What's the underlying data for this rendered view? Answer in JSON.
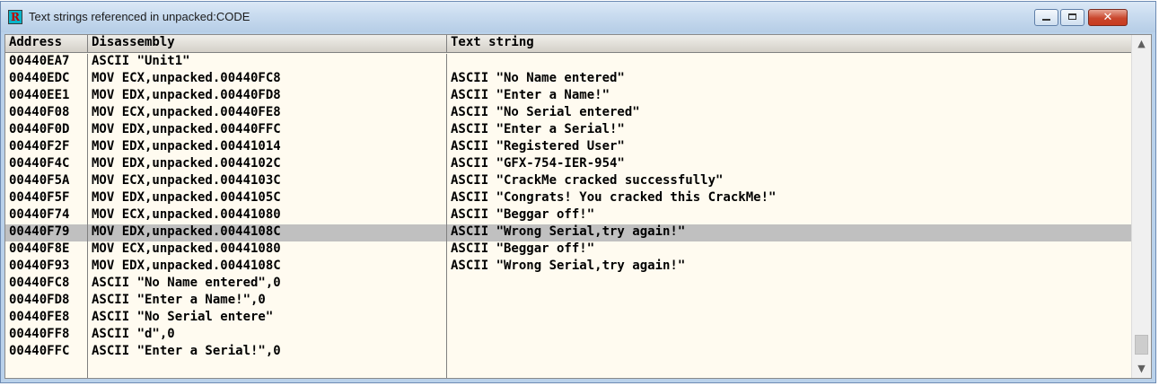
{
  "window": {
    "title": "Text strings referenced in unpacked:CODE",
    "app_icon_letter": "R",
    "controls": {
      "minimize": "minimize",
      "maximize": "maximize",
      "close": "✕"
    }
  },
  "table": {
    "columns": [
      "Address",
      "Disassembly",
      "Text string"
    ],
    "selected_row": 10,
    "rows": [
      {
        "address": "00440EA7",
        "disassembly": "ASCII \"Unit1\"",
        "text": ""
      },
      {
        "address": "00440EDC",
        "disassembly": "MOV ECX,unpacked.00440FC8",
        "text": "ASCII \"No Name entered\""
      },
      {
        "address": "00440EE1",
        "disassembly": "MOV EDX,unpacked.00440FD8",
        "text": "ASCII \"Enter a Name!\""
      },
      {
        "address": "00440F08",
        "disassembly": "MOV ECX,unpacked.00440FE8",
        "text": "ASCII \"No Serial entered\""
      },
      {
        "address": "00440F0D",
        "disassembly": "MOV EDX,unpacked.00440FFC",
        "text": "ASCII \"Enter a Serial!\""
      },
      {
        "address": "00440F2F",
        "disassembly": "MOV EDX,unpacked.00441014",
        "text": "ASCII \"Registered User\""
      },
      {
        "address": "00440F4C",
        "disassembly": "MOV EDX,unpacked.0044102C",
        "text": "ASCII \"GFX-754-IER-954\""
      },
      {
        "address": "00440F5A",
        "disassembly": "MOV ECX,unpacked.0044103C",
        "text": "ASCII \"CrackMe cracked successfully\""
      },
      {
        "address": "00440F5F",
        "disassembly": "MOV EDX,unpacked.0044105C",
        "text": "ASCII \"Congrats! You cracked this CrackMe!\""
      },
      {
        "address": "00440F74",
        "disassembly": "MOV ECX,unpacked.00441080",
        "text": "ASCII \"Beggar off!\""
      },
      {
        "address": "00440F79",
        "disassembly": "MOV EDX,unpacked.0044108C",
        "text": "ASCII \"Wrong Serial,try again!\""
      },
      {
        "address": "00440F8E",
        "disassembly": "MOV ECX,unpacked.00441080",
        "text": "ASCII \"Beggar off!\""
      },
      {
        "address": "00440F93",
        "disassembly": "MOV EDX,unpacked.0044108C",
        "text": "ASCII \"Wrong Serial,try again!\""
      },
      {
        "address": "00440FC8",
        "disassembly": "ASCII \"No Name entered\",0",
        "text": ""
      },
      {
        "address": "00440FD8",
        "disassembly": "ASCII \"Enter a Name!\",0",
        "text": ""
      },
      {
        "address": "00440FE8",
        "disassembly": "ASCII \"No Serial entere\"",
        "text": ""
      },
      {
        "address": "00440FF8",
        "disassembly": "ASCII \"d\",0",
        "text": ""
      },
      {
        "address": "00440FFC",
        "disassembly": "ASCII \"Enter a Serial!\",0",
        "text": ""
      }
    ]
  },
  "scrollbar": {
    "up_icon": "▲",
    "down_icon": "▼"
  },
  "colors": {
    "selection": "#c0c0c0",
    "background": "#fffbf0",
    "header": "#d4d0c8"
  }
}
